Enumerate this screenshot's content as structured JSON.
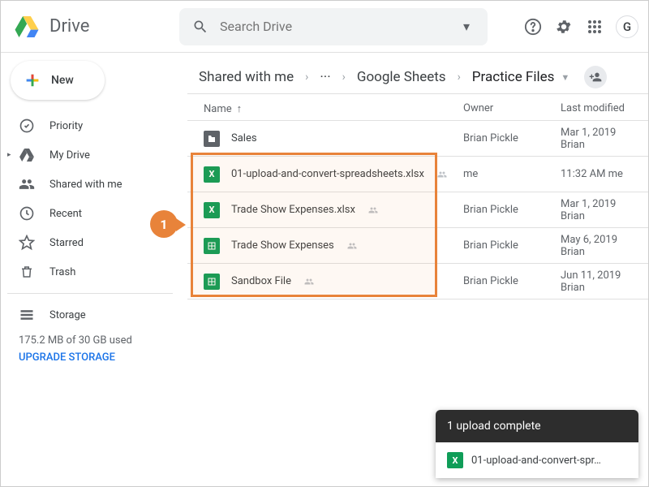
{
  "app": {
    "name": "Drive"
  },
  "search": {
    "placeholder": "Search Drive"
  },
  "newButton": {
    "label": "New"
  },
  "sidebar": {
    "items": [
      {
        "label": "Priority",
        "icon": "priority"
      },
      {
        "label": "My Drive",
        "icon": "mydrive"
      },
      {
        "label": "Shared with me",
        "icon": "shared"
      },
      {
        "label": "Recent",
        "icon": "recent"
      },
      {
        "label": "Starred",
        "icon": "star"
      },
      {
        "label": "Trash",
        "icon": "trash"
      }
    ],
    "storage": {
      "label": "Storage",
      "usage": "175.2 MB of 30 GB used",
      "upgrade": "UPGRADE STORAGE"
    }
  },
  "breadcrumbs": {
    "items": [
      "Shared with me",
      "···",
      "Google Sheets",
      "Practice Files"
    ]
  },
  "columns": {
    "name": "Name",
    "owner": "Owner",
    "modified": "Last modified"
  },
  "files": [
    {
      "type": "folder",
      "name": "Sales",
      "owner": "Brian Pickle",
      "modified": "Mar 1, 2019",
      "modifiedBy": "Brian",
      "shared": false
    },
    {
      "type": "xlsx",
      "name": "01-upload-and-convert-spreadsheets.xlsx",
      "owner": "me",
      "modified": "11:32 AM",
      "modifiedBy": "me",
      "shared": true
    },
    {
      "type": "xlsx",
      "name": "Trade Show Expenses.xlsx",
      "owner": "Brian Pickle",
      "modified": "Mar 1, 2019",
      "modifiedBy": "Brian",
      "shared": true
    },
    {
      "type": "sheet",
      "name": "Trade Show Expenses",
      "owner": "Brian Pickle",
      "modified": "May 6, 2019",
      "modifiedBy": "Brian",
      "shared": true
    },
    {
      "type": "sheet",
      "name": "Sandbox File",
      "owner": "Brian Pickle",
      "modified": "Jun 11, 2019",
      "modifiedBy": "Brian",
      "shared": true
    }
  ],
  "callout": {
    "number": "1"
  },
  "toast": {
    "title": "1 upload complete",
    "file": "01-upload-and-convert-spr…"
  },
  "accountLetter": "G"
}
